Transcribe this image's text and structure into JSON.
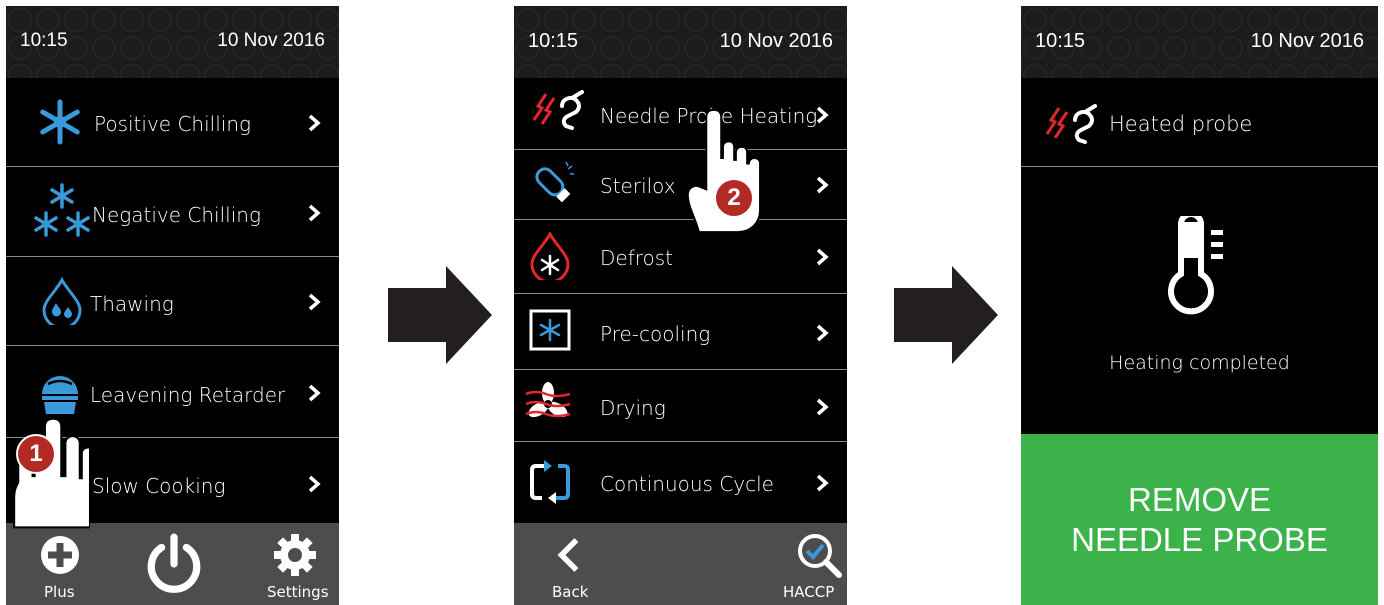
{
  "screen1": {
    "time": "10:15",
    "date": "10 Nov 2016",
    "items": [
      {
        "label": "Positive Chilling",
        "icon": "snowflake-icon"
      },
      {
        "label": "Negative Chilling",
        "icon": "three-snowflakes-icon"
      },
      {
        "label": "Thawing",
        "icon": "water-drops-icon"
      },
      {
        "label": "Leavening Retarder",
        "icon": "dome-icon"
      },
      {
        "label": "Slow Cooking",
        "icon": "pot-icon"
      }
    ],
    "bottom": {
      "plus_label": "Plus",
      "settings_label": "Settings"
    },
    "step_badge": "1"
  },
  "screen2": {
    "time": "10:15",
    "date": "10 Nov 2016",
    "items": [
      {
        "label": "Needle Probe Heating",
        "icon": "heated-probe-icon"
      },
      {
        "label": "Sterilox",
        "icon": "uv-lamp-icon"
      },
      {
        "label": "Defrost",
        "icon": "defrost-drop-icon"
      },
      {
        "label": "Pre-cooling",
        "icon": "precooling-box-icon"
      },
      {
        "label": "Drying",
        "icon": "drying-fan-icon"
      },
      {
        "label": "Continuous Cycle",
        "icon": "cycle-arrows-icon"
      }
    ],
    "bottom": {
      "back_label": "Back",
      "haccp_label": "HACCP"
    },
    "step_badge": "2"
  },
  "screen3": {
    "time": "10:15",
    "date": "10 Nov 2016",
    "title": "Heated probe",
    "status": "Heating completed",
    "button_line1": "REMOVE",
    "button_line2": "NEEDLE PROBE"
  },
  "colors": {
    "accent_blue": "#3a9ad9",
    "probe_red": "#e3262c",
    "remove_green": "#3bb34a",
    "bottom_bar": "#4d4d4d"
  }
}
